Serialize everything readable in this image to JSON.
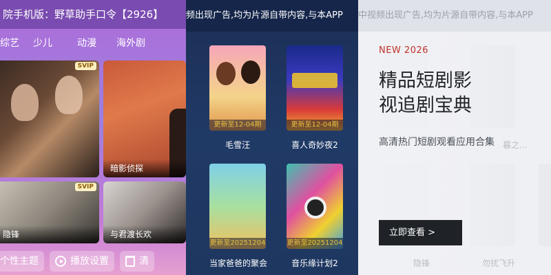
{
  "panel_left": {
    "title": "院手机版：野草助手口令【2926】",
    "categories": [
      "综艺",
      "少儿",
      "动漫",
      "海外剧"
    ],
    "cards": [
      {
        "caption": "",
        "svip": "SVIP"
      },
      {
        "caption": "暗影侦探",
        "svip": ""
      },
      {
        "caption": "隐锋",
        "svip": "SVIP"
      },
      {
        "caption": "与君渡长欢",
        "svip": ""
      }
    ],
    "bottom_buttons": [
      {
        "label": "个性主题",
        "icon": "palette-icon"
      },
      {
        "label": "播放设置",
        "icon": "play-circle-icon"
      },
      {
        "label": "清",
        "icon": "trash-icon"
      }
    ],
    "colors": {
      "bg": "#a77bdc",
      "header": "#7a4bb0"
    }
  },
  "panel_middle": {
    "marquee": "频出现广告,均为片源自带内容,与本APP",
    "items": [
      {
        "name": "毛雪汪",
        "update": "更新至12-04期"
      },
      {
        "name": "喜人奇妙夜2",
        "update": "更新至12-04期"
      },
      {
        "name": "当家爸爸的聚会",
        "update": "更新至20251204"
      },
      {
        "name": "音乐缘计划2",
        "update": "更新至20251204"
      }
    ],
    "colors": {
      "bg": "#1e3760",
      "update_text": "#e8c040"
    }
  },
  "panel_right": {
    "marquee": "中视频出现广告,均为片源自带内容,与本APP",
    "badge": "NEW 2026",
    "heading_line1": "精品短剧影",
    "heading_line2": "视追剧宝典",
    "subtitle": "高清热门短剧观看应用合集",
    "cta": "立即查看 >",
    "ghost_labels": [
      "隐锋",
      "勿扰飞升",
      "暮之..."
    ],
    "colors": {
      "badge": "#c0302a",
      "cta_bg": "#1f2328"
    }
  }
}
